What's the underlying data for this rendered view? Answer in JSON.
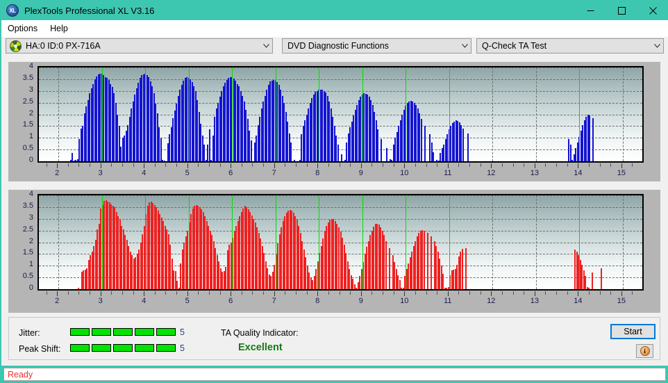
{
  "window": {
    "title": "PlexTools Professional XL V3.16",
    "app_icon": "xl-disc-icon",
    "minimize": "minimize-icon",
    "maximize": "maximize-icon",
    "close": "close-icon"
  },
  "menu": {
    "items": [
      {
        "label": "Options"
      },
      {
        "label": "Help"
      }
    ]
  },
  "toolbar": {
    "drive_combo": {
      "value": "HA:0 ID:0  PX-716A",
      "icon": "disc-icon"
    },
    "function_combo": {
      "value": "DVD Diagnostic Functions"
    },
    "test_combo": {
      "value": "Q-Check TA Test"
    }
  },
  "controls": {
    "jitter_label": "Jitter:",
    "jitter_value": "5",
    "jitter_segments": 5,
    "peak_shift_label": "Peak Shift:",
    "peak_shift_value": "5",
    "peak_shift_segments": 5,
    "ta_quality_label": "TA Quality Indicator:",
    "ta_quality_value": "Excellent",
    "start_label": "Start",
    "info_label": "i",
    "meter_color": "#00e500",
    "quality_color": "#157a15",
    "focus_color": "#0078d7"
  },
  "statusbar": {
    "text": "Ready",
    "color": "#f03030"
  },
  "chart_data": [
    {
      "id": "jitter-chart",
      "type": "bar",
      "title": "",
      "xlabel": "",
      "ylabel": "",
      "series_color": "#1414d2",
      "marker_color": "#00dd00",
      "grid": true,
      "xlim": [
        1.55,
        15.45
      ],
      "ylim": [
        0,
        4
      ],
      "ytick_labels": [
        "0",
        "0.5",
        "1",
        "1.5",
        "2",
        "2.5",
        "3",
        "3.5",
        "4"
      ],
      "yticks": [
        0,
        0.5,
        1,
        1.5,
        2,
        2.5,
        3,
        3.5,
        4
      ],
      "xtick_labels": [
        "2",
        "3",
        "4",
        "5",
        "6",
        "7",
        "8",
        "9",
        "10",
        "11",
        "12",
        "13",
        "14",
        "15"
      ],
      "xticks": [
        2,
        3,
        4,
        5,
        6,
        7,
        8,
        9,
        10,
        11,
        12,
        13,
        14,
        15
      ],
      "marker_x": [
        3,
        4,
        5,
        6,
        7,
        8,
        9,
        10,
        11,
        14
      ],
      "x": [
        2.28,
        2.32,
        2.36,
        2.4,
        2.44,
        2.48,
        2.52,
        2.56,
        2.6,
        2.64,
        2.68,
        2.72,
        2.76,
        2.8,
        2.84,
        2.88,
        2.92,
        2.96,
        3.0,
        3.04,
        3.08,
        3.12,
        3.16,
        3.2,
        3.24,
        3.28,
        3.32,
        3.36,
        3.4,
        3.44,
        3.48,
        3.52,
        3.56,
        3.6,
        3.64,
        3.68,
        3.72,
        3.76,
        3.8,
        3.84,
        3.88,
        3.92,
        3.96,
        4.0,
        4.04,
        4.08,
        4.12,
        4.16,
        4.2,
        4.24,
        4.28,
        4.32,
        4.36,
        4.4,
        4.44,
        4.52,
        4.56,
        4.6,
        4.64,
        4.68,
        4.72,
        4.76,
        4.8,
        4.84,
        4.88,
        4.92,
        4.96,
        5.0,
        5.04,
        5.08,
        5.12,
        5.16,
        5.2,
        5.24,
        5.28,
        5.32,
        5.36,
        5.4,
        5.44,
        5.48,
        5.52,
        5.56,
        5.6,
        5.64,
        5.68,
        5.72,
        5.76,
        5.8,
        5.84,
        5.88,
        5.92,
        5.96,
        6.0,
        6.04,
        6.08,
        6.12,
        6.16,
        6.2,
        6.24,
        6.28,
        6.32,
        6.36,
        6.4,
        6.44,
        6.52,
        6.56,
        6.6,
        6.64,
        6.68,
        6.72,
        6.76,
        6.8,
        6.84,
        6.88,
        6.92,
        6.96,
        7.0,
        7.04,
        7.08,
        7.12,
        7.16,
        7.2,
        7.24,
        7.28,
        7.32,
        7.36,
        7.44,
        7.56,
        7.6,
        7.64,
        7.68,
        7.72,
        7.76,
        7.8,
        7.84,
        7.88,
        7.92,
        7.96,
        8.0,
        8.04,
        8.08,
        8.12,
        8.16,
        8.2,
        8.24,
        8.28,
        8.32,
        8.36,
        8.4,
        8.44,
        8.52,
        8.6,
        8.64,
        8.68,
        8.72,
        8.76,
        8.8,
        8.84,
        8.88,
        8.92,
        8.96,
        9.0,
        9.04,
        9.08,
        9.12,
        9.16,
        9.2,
        9.24,
        9.28,
        9.32,
        9.36,
        9.44,
        9.56,
        9.64,
        9.68,
        9.72,
        9.76,
        9.8,
        9.84,
        9.88,
        9.92,
        9.96,
        10.0,
        10.04,
        10.08,
        10.12,
        10.16,
        10.2,
        10.24,
        10.28,
        10.32,
        10.36,
        10.44,
        10.56,
        10.6,
        10.64,
        10.72,
        10.76,
        10.8,
        10.84,
        10.88,
        10.92,
        10.96,
        11.0,
        11.04,
        11.08,
        11.12,
        11.16,
        11.2,
        11.24,
        11.28,
        11.32,
        11.44,
        13.76,
        13.8,
        13.84,
        13.88,
        13.92,
        13.96,
        14.0,
        14.04,
        14.08,
        14.12,
        14.16,
        14.2,
        14.24,
        14.32
      ],
      "values": [
        0.05,
        0.35,
        0.03,
        0.05,
        0.08,
        0.95,
        1.4,
        1.5,
        2.05,
        2.35,
        2.6,
        2.9,
        3.1,
        3.3,
        3.5,
        3.62,
        3.7,
        3.72,
        3.74,
        3.68,
        3.6,
        3.55,
        3.48,
        3.3,
        3.18,
        2.9,
        2.5,
        2.0,
        1.5,
        0.62,
        1.0,
        1.1,
        1.3,
        1.55,
        1.9,
        2.25,
        2.55,
        2.85,
        3.1,
        3.35,
        3.55,
        3.66,
        3.7,
        3.72,
        3.68,
        3.58,
        3.4,
        3.2,
        2.9,
        2.45,
        2.05,
        1.45,
        0.98,
        0.05,
        0.04,
        0.78,
        1.15,
        1.45,
        1.85,
        2.15,
        2.45,
        2.8,
        3.05,
        3.25,
        3.45,
        3.56,
        3.58,
        3.56,
        3.5,
        3.38,
        3.2,
        3.0,
        2.6,
        2.1,
        1.6,
        1.1,
        0.7,
        0.06,
        0.72,
        1.35,
        0.05,
        1.1,
        1.9,
        2.25,
        2.5,
        2.75,
        3.0,
        3.2,
        3.35,
        3.48,
        3.56,
        3.6,
        3.58,
        3.52,
        3.45,
        3.3,
        3.2,
        3.0,
        2.8,
        2.55,
        2.2,
        1.8,
        1.3,
        0.9,
        0.8,
        1.1,
        1.55,
        1.9,
        2.25,
        2.55,
        2.8,
        3.05,
        3.25,
        3.4,
        3.45,
        3.46,
        3.44,
        3.38,
        3.25,
        3.05,
        2.8,
        2.5,
        2.1,
        1.7,
        1.2,
        0.8,
        0.05,
        0.05,
        1.15,
        1.5,
        1.75,
        2.0,
        2.25,
        2.5,
        2.7,
        2.85,
        2.95,
        3.0,
        3.05,
        3.06,
        3.04,
        3.0,
        2.92,
        2.78,
        2.55,
        2.25,
        1.9,
        1.5,
        1.1,
        0.7,
        0.3,
        0.05,
        0.8,
        1.2,
        1.45,
        1.7,
        1.95,
        2.2,
        2.4,
        2.6,
        2.75,
        2.85,
        2.9,
        2.88,
        2.84,
        2.75,
        2.6,
        2.4,
        2.1,
        1.75,
        1.35,
        0.95,
        0.55,
        0.08,
        0.05,
        0.7,
        1.0,
        1.25,
        1.5,
        1.75,
        2.0,
        2.2,
        2.38,
        2.5,
        2.56,
        2.58,
        2.56,
        2.5,
        2.4,
        2.25,
        2.05,
        1.8,
        1.5,
        1.15,
        0.8,
        0.4,
        0.06,
        0.03,
        0.35,
        0.55,
        0.7,
        0.95,
        1.15,
        1.35,
        1.5,
        1.62,
        1.7,
        1.74,
        1.72,
        1.66,
        1.55,
        1.4,
        1.2,
        0.95,
        0.7,
        0.05,
        0.3,
        0.55,
        0.8,
        1.05,
        1.3,
        1.55,
        1.75,
        1.9,
        2.0,
        1.95,
        1.85,
        1.7,
        1.45,
        1.15,
        0.85,
        0.05
      ]
    },
    {
      "id": "peak-shift-chart",
      "type": "bar",
      "title": "",
      "xlabel": "",
      "ylabel": "",
      "series_color": "#ef2020",
      "marker_color": "#00dd00",
      "grid": true,
      "xlim": [
        1.55,
        15.45
      ],
      "ylim": [
        0,
        4
      ],
      "ytick_labels": [
        "0",
        "0.5",
        "1",
        "1.5",
        "2",
        "2.5",
        "3",
        "3.5",
        "4"
      ],
      "yticks": [
        0,
        0.5,
        1,
        1.5,
        2,
        2.5,
        3,
        3.5,
        4
      ],
      "xtick_labels": [
        "2",
        "3",
        "4",
        "5",
        "6",
        "7",
        "8",
        "9",
        "10",
        "11",
        "12",
        "13",
        "14",
        "15"
      ],
      "xticks": [
        2,
        3,
        4,
        5,
        6,
        7,
        8,
        9,
        10,
        11,
        12,
        13,
        14,
        15
      ],
      "marker_x": [
        3,
        4,
        5,
        6,
        7,
        8,
        9,
        10,
        11,
        14
      ],
      "x": [
        2.46,
        2.54,
        2.58,
        2.62,
        2.66,
        2.7,
        2.74,
        2.78,
        2.82,
        2.86,
        2.9,
        2.94,
        2.98,
        3.02,
        3.06,
        3.1,
        3.14,
        3.18,
        3.22,
        3.26,
        3.3,
        3.34,
        3.38,
        3.42,
        3.46,
        3.5,
        3.54,
        3.58,
        3.62,
        3.66,
        3.7,
        3.74,
        3.78,
        3.82,
        3.86,
        3.9,
        3.94,
        3.98,
        4.02,
        4.06,
        4.1,
        4.14,
        4.18,
        4.22,
        4.26,
        4.3,
        4.34,
        4.38,
        4.42,
        4.46,
        4.5,
        4.54,
        4.58,
        4.62,
        4.66,
        4.7,
        4.74,
        4.78,
        4.82,
        4.86,
        4.9,
        4.94,
        4.98,
        5.02,
        5.06,
        5.1,
        5.14,
        5.18,
        5.22,
        5.26,
        5.3,
        5.34,
        5.38,
        5.42,
        5.46,
        5.5,
        5.54,
        5.58,
        5.62,
        5.66,
        5.7,
        5.74,
        5.78,
        5.82,
        5.86,
        5.9,
        5.94,
        5.98,
        6.02,
        6.06,
        6.1,
        6.14,
        6.18,
        6.22,
        6.26,
        6.3,
        6.34,
        6.38,
        6.42,
        6.46,
        6.5,
        6.54,
        6.58,
        6.62,
        6.66,
        6.7,
        6.74,
        6.78,
        6.82,
        6.86,
        6.9,
        6.94,
        6.98,
        7.02,
        7.06,
        7.1,
        7.14,
        7.18,
        7.22,
        7.26,
        7.3,
        7.34,
        7.38,
        7.42,
        7.46,
        7.5,
        7.54,
        7.58,
        7.62,
        7.66,
        7.7,
        7.74,
        7.78,
        7.82,
        7.86,
        7.9,
        7.94,
        7.98,
        8.02,
        8.06,
        8.1,
        8.14,
        8.18,
        8.22,
        8.26,
        8.3,
        8.34,
        8.38,
        8.42,
        8.46,
        8.5,
        8.54,
        8.58,
        8.62,
        8.66,
        8.7,
        8.74,
        8.78,
        8.82,
        8.86,
        8.9,
        8.94,
        8.98,
        9.02,
        9.06,
        9.1,
        9.14,
        9.18,
        9.22,
        9.26,
        9.3,
        9.34,
        9.38,
        9.42,
        9.46,
        9.5,
        9.54,
        9.62,
        9.7,
        9.74,
        9.78,
        9.82,
        9.86,
        9.9,
        9.94,
        9.98,
        10.02,
        10.06,
        10.1,
        10.14,
        10.18,
        10.22,
        10.26,
        10.3,
        10.34,
        10.38,
        10.42,
        10.5,
        10.58,
        10.66,
        10.7,
        10.74,
        10.78,
        10.82,
        10.86,
        10.9,
        10.94,
        10.98,
        11.02,
        11.06,
        11.1,
        11.14,
        11.18,
        11.22,
        11.26,
        11.3,
        11.38,
        13.9,
        13.94,
        13.98,
        14.02,
        14.06,
        14.1,
        14.14,
        14.18,
        14.22,
        14.3,
        14.5
      ],
      "values": [
        0.05,
        0.75,
        0.8,
        0.82,
        0.9,
        1.25,
        1.45,
        1.6,
        1.85,
        2.1,
        2.55,
        2.8,
        3.45,
        3.6,
        3.75,
        3.78,
        3.74,
        3.7,
        3.62,
        3.55,
        3.5,
        3.3,
        3.1,
        2.95,
        2.7,
        2.55,
        2.3,
        2.1,
        1.85,
        1.6,
        1.45,
        1.3,
        1.35,
        1.5,
        1.7,
        2.0,
        2.35,
        2.7,
        3.2,
        3.55,
        3.7,
        3.72,
        3.68,
        3.6,
        3.5,
        3.35,
        3.2,
        3.05,
        2.9,
        2.7,
        2.55,
        2.35,
        1.9,
        1.3,
        0.8,
        0.78,
        0.35,
        0.05,
        1.1,
        1.7,
        2.0,
        2.25,
        2.5,
        2.85,
        3.2,
        3.45,
        3.55,
        3.58,
        3.55,
        3.5,
        3.4,
        3.3,
        3.1,
        2.9,
        2.7,
        2.5,
        2.3,
        2.05,
        1.75,
        1.45,
        1.2,
        0.9,
        0.75,
        0.78,
        0.95,
        1.65,
        1.9,
        2.0,
        2.2,
        2.45,
        2.7,
        2.9,
        3.1,
        3.3,
        3.45,
        3.55,
        3.5,
        3.4,
        3.3,
        3.15,
        3.0,
        2.85,
        2.65,
        2.4,
        2.15,
        1.85,
        1.55,
        1.2,
        0.9,
        0.62,
        0.55,
        0.75,
        1.05,
        1.5,
        1.95,
        2.35,
        2.65,
        2.9,
        3.1,
        3.25,
        3.35,
        3.38,
        3.35,
        3.25,
        3.1,
        2.95,
        2.7,
        2.4,
        2.05,
        1.7,
        1.35,
        1.0,
        0.7,
        0.5,
        0.4,
        0.55,
        0.85,
        1.2,
        1.55,
        1.85,
        2.15,
        2.45,
        2.7,
        2.85,
        2.95,
        3.0,
        2.98,
        2.9,
        2.8,
        2.65,
        2.45,
        2.2,
        1.9,
        1.55,
        1.2,
        0.85,
        0.6,
        0.45,
        0.2,
        0.05,
        0.3,
        0.55,
        0.85,
        1.15,
        1.5,
        1.8,
        2.05,
        2.3,
        2.5,
        2.68,
        2.78,
        2.8,
        2.75,
        2.65,
        2.5,
        2.3,
        2.05,
        1.75,
        1.45,
        1.15,
        0.85,
        0.6,
        0.4,
        0.05,
        0.05,
        0.55,
        0.85,
        1.1,
        1.35,
        1.6,
        1.85,
        2.05,
        2.25,
        2.4,
        2.5,
        2.52,
        2.48,
        2.4,
        2.25,
        2.05,
        1.85,
        1.6,
        1.3,
        1.0,
        0.65,
        0.06,
        0.05,
        0.08,
        0.6,
        0.8,
        0.82,
        0.85,
        1.05,
        1.4,
        1.6,
        1.72,
        1.75,
        1.7,
        1.6,
        1.45,
        1.25,
        1.05,
        0.8,
        0.55,
        0.08,
        0.05,
        0.7,
        0.9,
        1.05,
        1.15,
        1.1,
        1.0,
        0.95,
        0.9,
        0.55,
        0.12
      ]
    }
  ]
}
